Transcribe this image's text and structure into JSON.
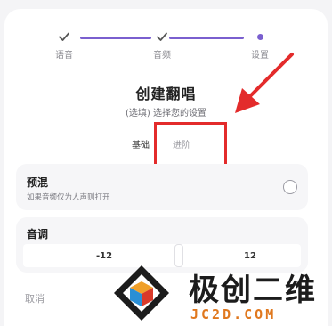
{
  "stepper": {
    "steps": [
      {
        "label": "语音",
        "state": "done"
      },
      {
        "label": "音频",
        "state": "done"
      },
      {
        "label": "设置",
        "state": "current"
      }
    ],
    "accent": "#7a5fcf"
  },
  "header": {
    "title": "创建翻唱",
    "subtitle": "(选填) 选择您的设置"
  },
  "tabs": {
    "basic": "基础",
    "advanced": "进阶"
  },
  "premix": {
    "title": "预混",
    "description": "如果音频仅为人声则打开",
    "selected": false
  },
  "pitch": {
    "title": "音调",
    "min_label": "-12",
    "max_label": "12",
    "value": 0
  },
  "footer": {
    "cancel_label": "取消"
  },
  "annotation": {
    "color": "#e32b2b"
  },
  "watermark": {
    "text_cn": "极创二维",
    "text_en": "JC2D.COM",
    "color_en": "#e0781e"
  }
}
